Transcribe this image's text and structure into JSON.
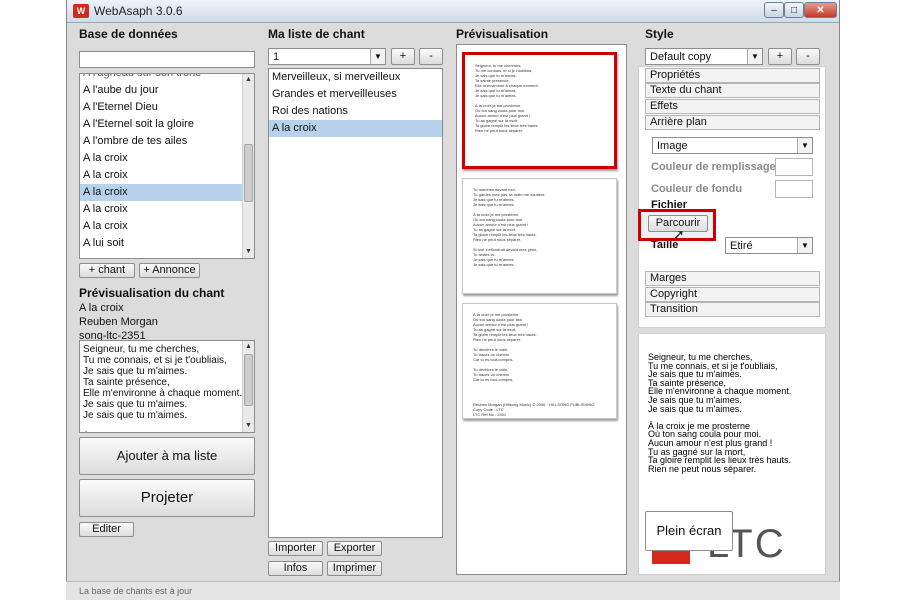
{
  "window": {
    "title": "WebAsaph 3.0.6",
    "min": "–",
    "max": "□",
    "close": "✕"
  },
  "db": {
    "header": "Base de données",
    "search_value": "",
    "partial_item": "A l'agneau sur son trône",
    "items": [
      {
        "label": "A l'aube du jour",
        "selected": false
      },
      {
        "label": "A l'Eternel Dieu",
        "selected": false
      },
      {
        "label": "A l'Eternel soit la gloire",
        "selected": false
      },
      {
        "label": "A l'ombre de tes ailes",
        "selected": false
      },
      {
        "label": "A la croix",
        "selected": false
      },
      {
        "label": "A la croix",
        "selected": false
      },
      {
        "label": "A la croix",
        "selected": true
      },
      {
        "label": "A la croix",
        "selected": false
      },
      {
        "label": "A la croix",
        "selected": false
      },
      {
        "label": "A lui soit",
        "selected": false
      }
    ],
    "add_chant": "+ chant",
    "add_annonce": "+ Annonce"
  },
  "song_preview": {
    "header": "Prévisualisation du chant",
    "title": "A la croix",
    "author": "Reuben Morgan",
    "code": "song-ltc-2351",
    "lyrics": "Seigneur, tu me cherches,\nTu me connais, et si je t'oubliais,\nJe sais que tu m'aimes.\nTa sainte présence,\nElle m'environne à chaque moment.\nJe sais que tu m'aimes.\nJe sais que tu m'aimes.\n\nÀ la croix je me prosterne\nOù ton sang coula pour moi.",
    "add_to_list": "Ajouter à ma liste",
    "project": "Projeter",
    "edit": "Editer"
  },
  "mylist": {
    "header": "Ma liste de chant",
    "selector_value": "1",
    "plus": "+",
    "minus": "-",
    "items": [
      {
        "label": "Merveilleux, si merveilleux",
        "selected": false
      },
      {
        "label": "Grandes et merveilleuses",
        "selected": false
      },
      {
        "label": "Roi des nations",
        "selected": false
      },
      {
        "label": "A la croix",
        "selected": true
      }
    ],
    "import": "Importer",
    "export": "Exporter",
    "infos": "Infos",
    "print": "Imprimer"
  },
  "preview": {
    "header": "Prévisualisation",
    "pages": [
      {
        "lines": [
          "Seigneur, tu me cherches,",
          "Tu me connais, et si je t'oubliais,",
          "Je sais que tu m'aimes.",
          "Ta sainte présence,",
          "Elle m'environne à chaque moment.",
          "Je sais que tu m'aimes.",
          "Je sais que tu m'aimes.",
          "",
          "À la croix je me prosterne",
          "Où ton sang coula pour moi.",
          "Aucun amour n'est plus grand !",
          "Tu as gagné sur la mort,",
          "Ta gloire remplit les lieux très hauts.",
          "Rien ne peut nous séparer."
        ]
      },
      {
        "lines": [
          "Tu marches devant moi,",
          "Tu gardes mes pas, ta main me soutient.",
          "Je sais que tu m'aimes.",
          "Je sais que tu m'aimes.",
          "",
          "À la croix je me prosterne",
          "Où ton sang coula pour moi.",
          "Aucun amour n'est plus grand !",
          "Tu as gagné sur la mort,",
          "Ta gloire remplit les lieux très hauts.",
          "Rien ne peut nous séparer.",
          "",
          "Si tout s'effondrait devant mes yeux,",
          "Tu restes là.",
          "Je sais que tu m'aimes.",
          "Je sais que tu m'aimes."
        ]
      },
      {
        "lines": [
          "À la croix je me prosterne",
          "Où ton sang coula pour moi.",
          "Aucun amour n'est plus grand !",
          "Tu as gagné sur la mort,",
          "Ta gloire remplit les lieux très hauts.",
          "Rien ne peut nous séparer.",
          "",
          "Tu déchires le voile,",
          "Tu traces un chemin",
          "Car tu es tout-compris.",
          "",
          "Tu déchires le voile,",
          "Tu traces un chemin",
          "Car tu es tout-compris.",
          "",
          "",
          "",
          "",
          "Reuben Morgan (Hillsong Music) © 2006 · HILLSONG PUBLISHING",
          "Copy Code : LTC",
          "LTC Ref No : 2351"
        ]
      }
    ]
  },
  "style": {
    "header": "Style",
    "selector_value": "Default copy",
    "plus": "+",
    "minus": "-",
    "sections": {
      "props": "Propriétés",
      "texte": "Texte du chant",
      "effets": "Effets",
      "arriere": "Arrière plan",
      "marges": "Marges",
      "copyright": "Copyright",
      "transition": "Transition"
    },
    "bg_type": "Image",
    "fill_color_label": "Couleur de remplissage",
    "fade_color_label": "Couleur de fondu",
    "file_label": "Fichier",
    "browse": "Parcourir",
    "size_label": "Taille",
    "size_value": "Etiré"
  },
  "live": {
    "lyrics": "Seigneur, tu me cherches,\nTu me connais, et si je t'oubliais,\nJe sais que tu m'aimes.\nTa sainte présence,\nElle m'environne à chaque moment.\nJe sais que tu m'aimes.\nJe sais que tu m'aimes.\n\nÀ la croix je me prosterne\nOù ton sang coula pour moi.\nAucun amour n'est plus grand !\nTu as gagné sur la mort,\nTa gloire remplit les lieux très hauts.\nRien ne peut nous séparer.",
    "fullscreen": "Plein écran",
    "logo_text": "LTC"
  },
  "status": {
    "text": "La base de chants est à jour"
  },
  "colors": {
    "highlight": "#cc0000",
    "selection": "#b8d2ee",
    "logo_red": "#d42a1e"
  }
}
